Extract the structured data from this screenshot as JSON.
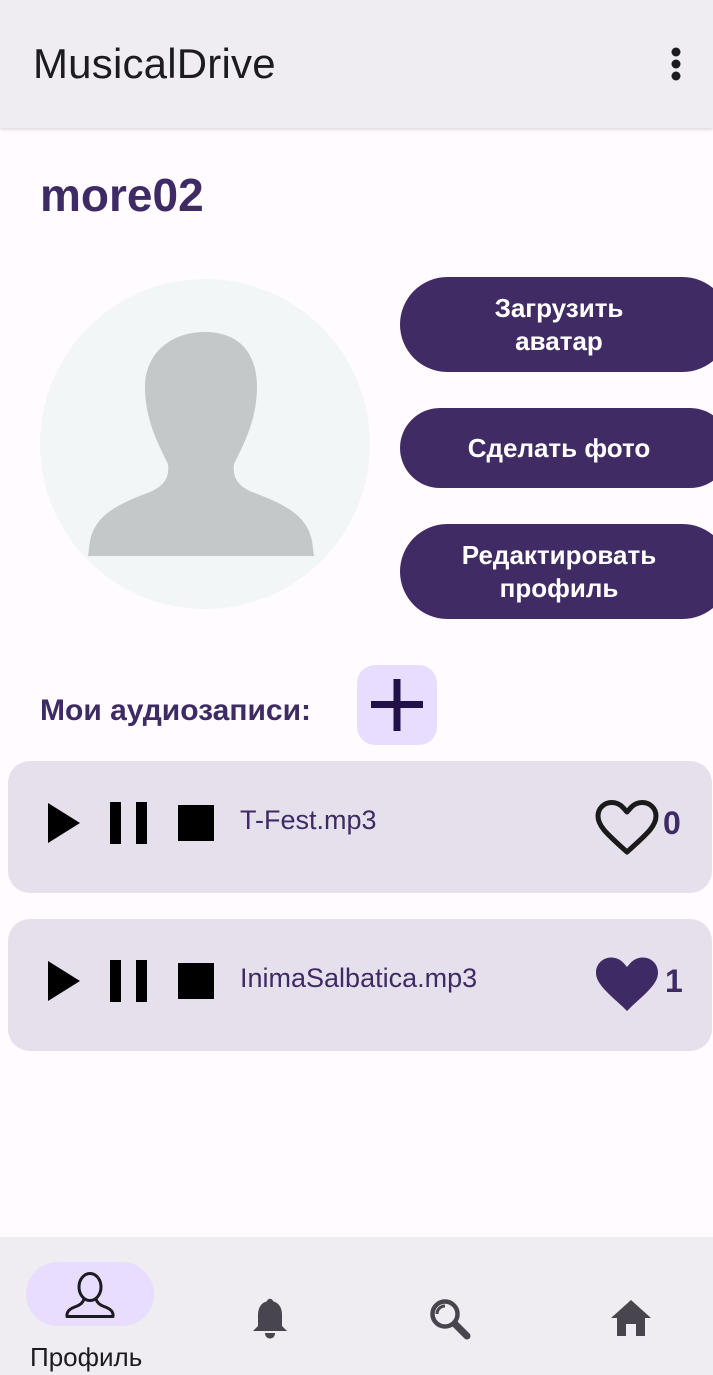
{
  "app_bar": {
    "title": "MusicalDrive",
    "menu_icon": "more-vert-icon"
  },
  "profile": {
    "username": "more02",
    "avatar_icon": "default-avatar-silhouette",
    "buttons": {
      "upload_avatar": "Загрузить\nаватар",
      "take_photo": "Сделать фото",
      "edit_profile": "Редактировать\nпрофиль"
    }
  },
  "audio": {
    "section_label": "Мои аудиозаписи:",
    "add_icon": "plus-icon",
    "tracks": [
      {
        "name": "T-Fest.mp3",
        "likes": "0",
        "liked": false
      },
      {
        "name": "InimaSalbatica.mp3",
        "likes": "1",
        "liked": true
      }
    ]
  },
  "bottom_nav": {
    "items": [
      {
        "label": "Профиль",
        "icon": "person-outline-icon",
        "active": true
      },
      {
        "label": "",
        "icon": "bell-icon",
        "active": false
      },
      {
        "label": "",
        "icon": "search-icon",
        "active": false
      },
      {
        "label": "",
        "icon": "home-icon",
        "active": false
      }
    ]
  },
  "colors": {
    "primary": "#412b65",
    "track_bg": "#e6e0ec",
    "accent_container": "#e8ddff",
    "background": "#fffbfe",
    "bar_bg": "#efedf1"
  }
}
